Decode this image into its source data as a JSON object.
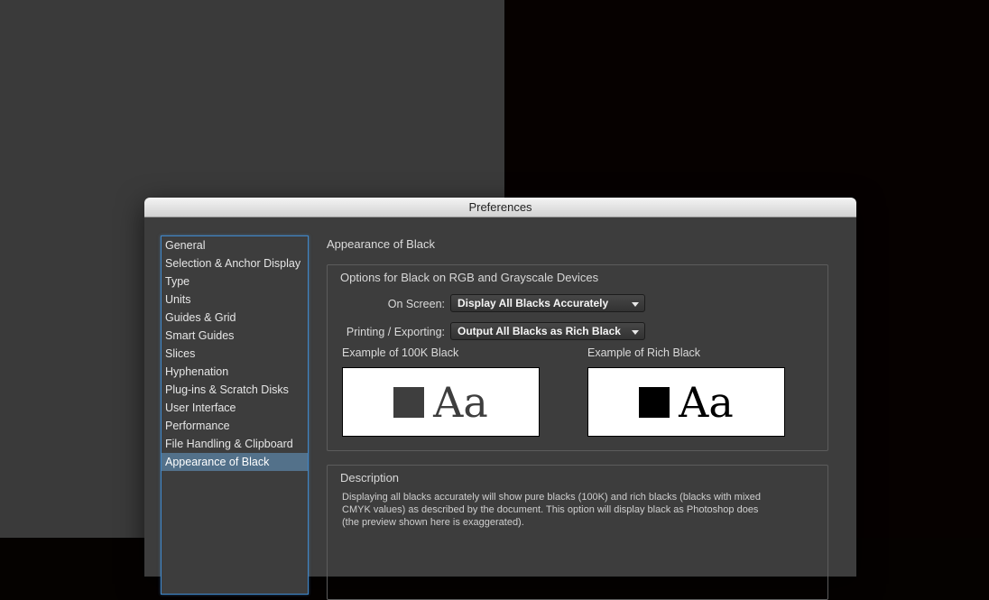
{
  "window": {
    "title": "Preferences"
  },
  "sidebar": {
    "items": [
      "General",
      "Selection & Anchor Display",
      "Type",
      "Units",
      "Guides & Grid",
      "Smart Guides",
      "Slices",
      "Hyphenation",
      "Plug-ins & Scratch Disks",
      "User Interface",
      "Performance",
      "File Handling & Clipboard",
      "Appearance of Black"
    ],
    "selected_index": 12
  },
  "panel": {
    "title": "Appearance of Black",
    "options_group": {
      "title": "Options for Black on RGB and Grayscale Devices",
      "on_screen_label": "On Screen:",
      "on_screen_value": "Display All Blacks Accurately",
      "printing_label": "Printing / Exporting:",
      "printing_value": "Output All Blacks as Rich Black",
      "example_100k_label": "Example of 100K Black",
      "example_rich_label": "Example of Rich Black",
      "example_text": "Aa"
    },
    "description_group": {
      "title": "Description",
      "lines": [
        "Displaying all blacks accurately will show pure blacks (100K) and rich blacks (blacks with mixed",
        "CMYK values) as described by the document. This option will display black as Photoshop does",
        "(the preview shown here is exaggerated)."
      ]
    }
  },
  "colors": {
    "selection_highlight": "#53718a",
    "focus_ring": "#3f86c8",
    "dialog_background": "#3d3d3d",
    "rich_black": "#000000",
    "black_100k": "#3e3e3e"
  }
}
